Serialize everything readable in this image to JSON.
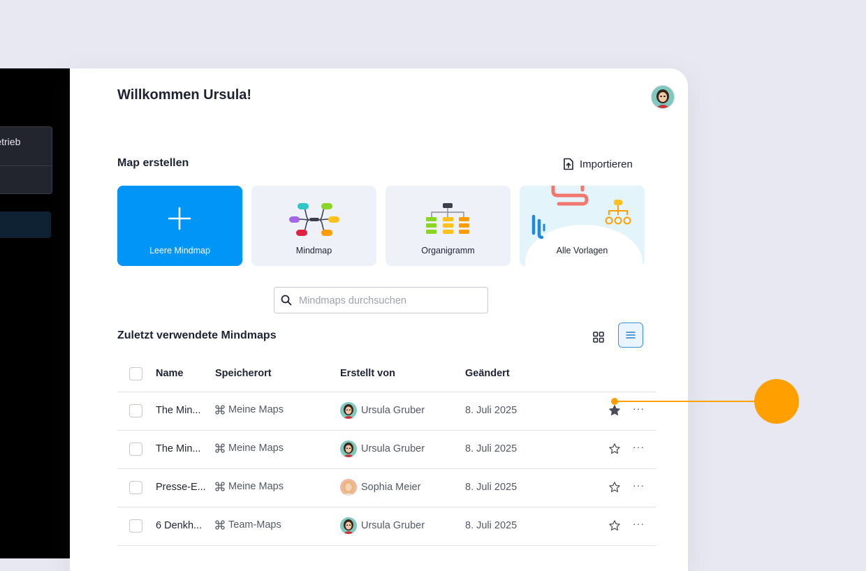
{
  "sidebar": {
    "workspace_label": "Betrieb"
  },
  "header": {
    "welcome": "Willkommen Ursula!"
  },
  "create": {
    "title": "Map erstellen",
    "import_label": "Importieren",
    "cards": [
      {
        "label": "Leere Mindmap"
      },
      {
        "label": "Mindmap"
      },
      {
        "label": "Organigramm"
      },
      {
        "label": "Alle Vorlagen"
      }
    ]
  },
  "search": {
    "placeholder": "Mindmaps durchsuchen"
  },
  "recent": {
    "title": "Zuletzt verwendete Mindmaps",
    "columns": {
      "name": "Name",
      "location": "Speicherort",
      "created_by": "Erstellt von",
      "changed": "Geändert"
    },
    "rows": [
      {
        "name": "The Min...",
        "location": "Meine Maps",
        "created_by": "Ursula Gruber",
        "changed": "8. Juli 2025",
        "starred": true,
        "avatar": "ursula"
      },
      {
        "name": "The Min...",
        "location": "Meine Maps",
        "created_by": "Ursula Gruber",
        "changed": "8. Juli 2025",
        "starred": false,
        "avatar": "ursula"
      },
      {
        "name": "Presse-E...",
        "location": "Meine Maps",
        "created_by": "Sophia Meier",
        "changed": "8. Juli 2025",
        "starred": false,
        "avatar": "sophia"
      },
      {
        "name": "6 Denkh...",
        "location": "Team-Maps",
        "created_by": "Ursula Gruber",
        "changed": "8. Juli 2025",
        "starred": false,
        "avatar": "ursula"
      }
    ],
    "more_label": "···"
  },
  "colors": {
    "accent": "#0095f7",
    "callout": "#ffa000",
    "sidebar": "#000000"
  }
}
